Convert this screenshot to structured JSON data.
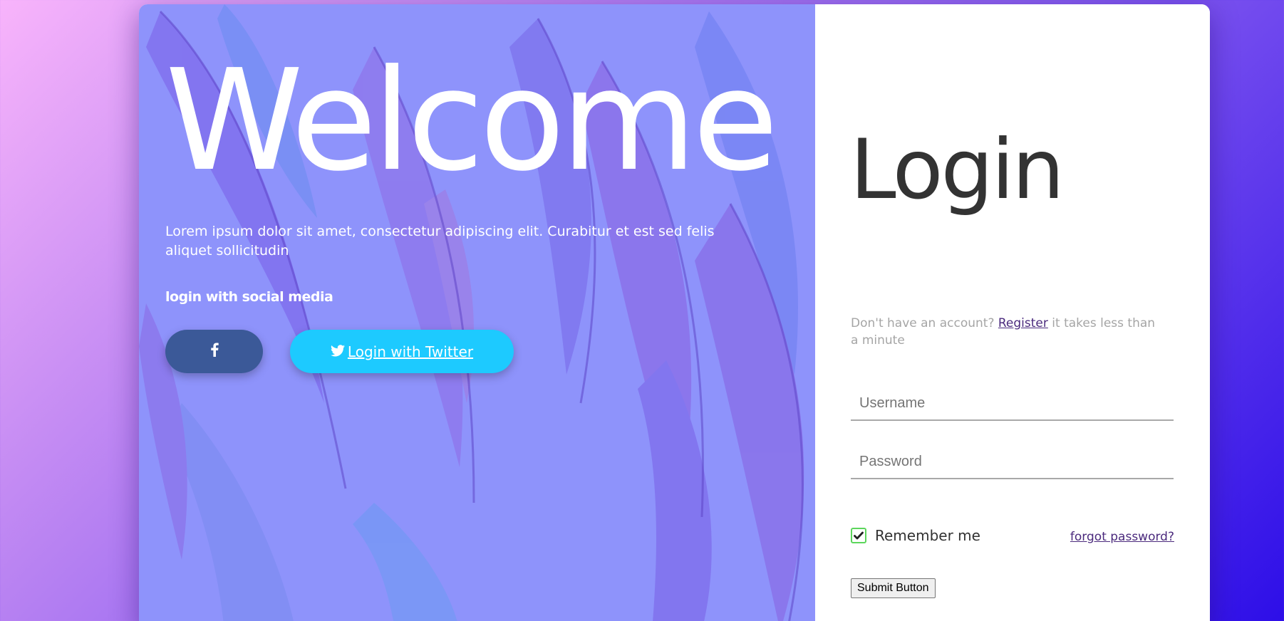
{
  "hero": {
    "title": "Welcome",
    "description": "Lorem ipsum dolor sit amet, consectetur adipiscing elit. Curabitur et est sed felis aliquet sollicitudin",
    "social_label": "login with social media",
    "facebook_icon": "facebook-icon",
    "twitter_label": " Login with Twitter",
    "twitter_icon": "twitter-icon"
  },
  "login": {
    "title": "Login",
    "register_prefix": "Don't have an account? ",
    "register_link": "Register",
    "register_suffix": " it takes less than a minute",
    "username_placeholder": "Username",
    "password_placeholder": "Password",
    "remember_label": "Remember me",
    "remember_checked": true,
    "forgot_link": "forgot password?",
    "submit_label": "Submit Button"
  },
  "colors": {
    "hero_bg": "#8e93fb",
    "facebook": "#3b5998",
    "twitter": "#1dcaff",
    "title_text": "#333333",
    "link": "#4b2a7d",
    "checkbox_border": "#5cd65c"
  }
}
